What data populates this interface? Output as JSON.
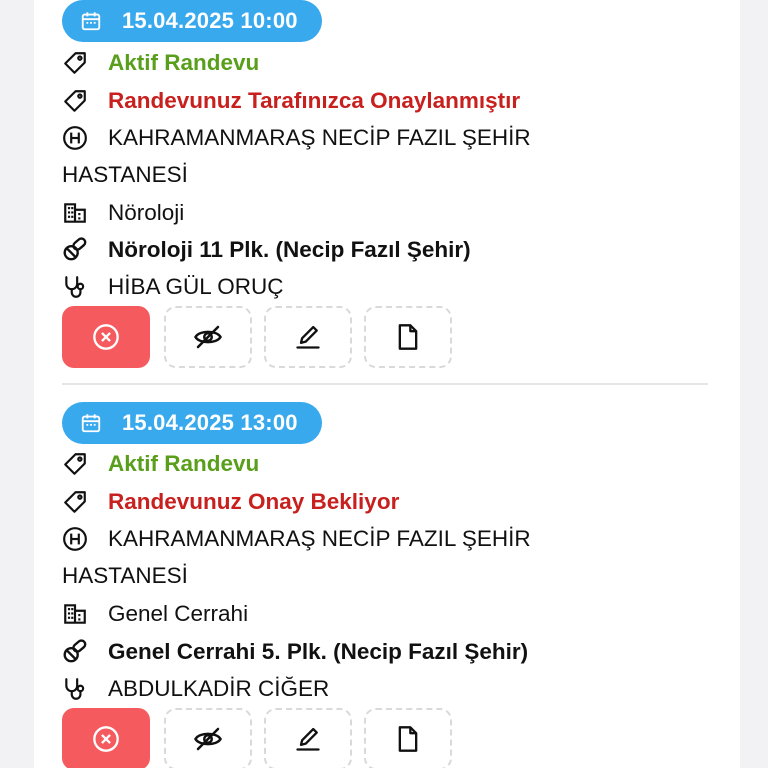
{
  "colors": {
    "date_pill": "#39a9ee",
    "status_active": "#5a9f1b",
    "status_approval": "#c8201e",
    "cancel_button": "#f55a5e"
  },
  "appointments": [
    {
      "datetime": "15.04.2025 10:00",
      "status": "Aktif Randevu",
      "approval": "Randevunuz Tarafınızca Onaylanmıştır",
      "hospital_line1": "KAHRAMANMARAŞ NECİP FAZIL ŞEHİR",
      "hospital_line2": "HASTANESİ",
      "department": "Nöroloji",
      "clinic": "Nöroloji 11 Plk. (Necip Fazıl Şehir)",
      "doctor": "HİBA GÜL ORUÇ",
      "actions": [
        "cancel-icon",
        "hide-icon",
        "edit-icon",
        "document-icon"
      ]
    },
    {
      "datetime": "15.04.2025 13:00",
      "status": "Aktif Randevu",
      "approval": "Randevunuz Onay Bekliyor",
      "hospital_line1": "KAHRAMANMARAŞ NECİP FAZIL ŞEHİR",
      "hospital_line2": "HASTANESİ",
      "department": "Genel Cerrahi",
      "clinic": "Genel Cerrahi 5. Plk. (Necip Fazıl Şehir)",
      "doctor": "ABDULKADİR CİĞER",
      "actions": [
        "cancel-icon",
        "hide-icon",
        "edit-icon",
        "document-icon"
      ]
    }
  ]
}
